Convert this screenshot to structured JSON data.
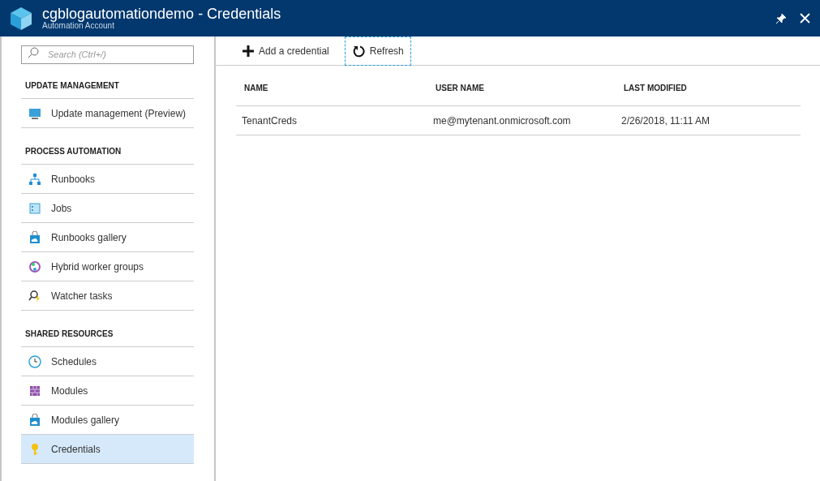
{
  "window": {
    "title": "cgblogautomationdemo - Credentials",
    "subtitle": "Automation Account"
  },
  "sidebar": {
    "search": {
      "placeholder": "Search (Ctrl+/)"
    },
    "sections": [
      {
        "title": "UPDATE MANAGEMENT",
        "items": [
          {
            "label": "Update management (Preview)",
            "selected": false
          }
        ]
      },
      {
        "title": "PROCESS AUTOMATION",
        "items": [
          {
            "label": "Runbooks",
            "selected": false
          },
          {
            "label": "Jobs",
            "selected": false
          },
          {
            "label": "Runbooks gallery",
            "selected": false
          },
          {
            "label": "Hybrid worker groups",
            "selected": false
          },
          {
            "label": "Watcher tasks",
            "selected": false
          }
        ]
      },
      {
        "title": "SHARED RESOURCES",
        "items": [
          {
            "label": "Schedules",
            "selected": false
          },
          {
            "label": "Modules",
            "selected": false
          },
          {
            "label": "Modules gallery",
            "selected": false
          },
          {
            "label": "Credentials",
            "selected": true
          }
        ]
      }
    ]
  },
  "toolbar": [
    {
      "label": "Add a credential",
      "focused": false
    },
    {
      "label": "Refresh",
      "focused": true
    }
  ],
  "table": {
    "columns": [
      "NAME",
      "USER NAME",
      "LAST MODIFIED"
    ],
    "rows": [
      [
        "TenantCreds",
        "me@mytenant.onmicrosoft.com",
        "2/26/2018, 11:11 AM"
      ]
    ]
  }
}
